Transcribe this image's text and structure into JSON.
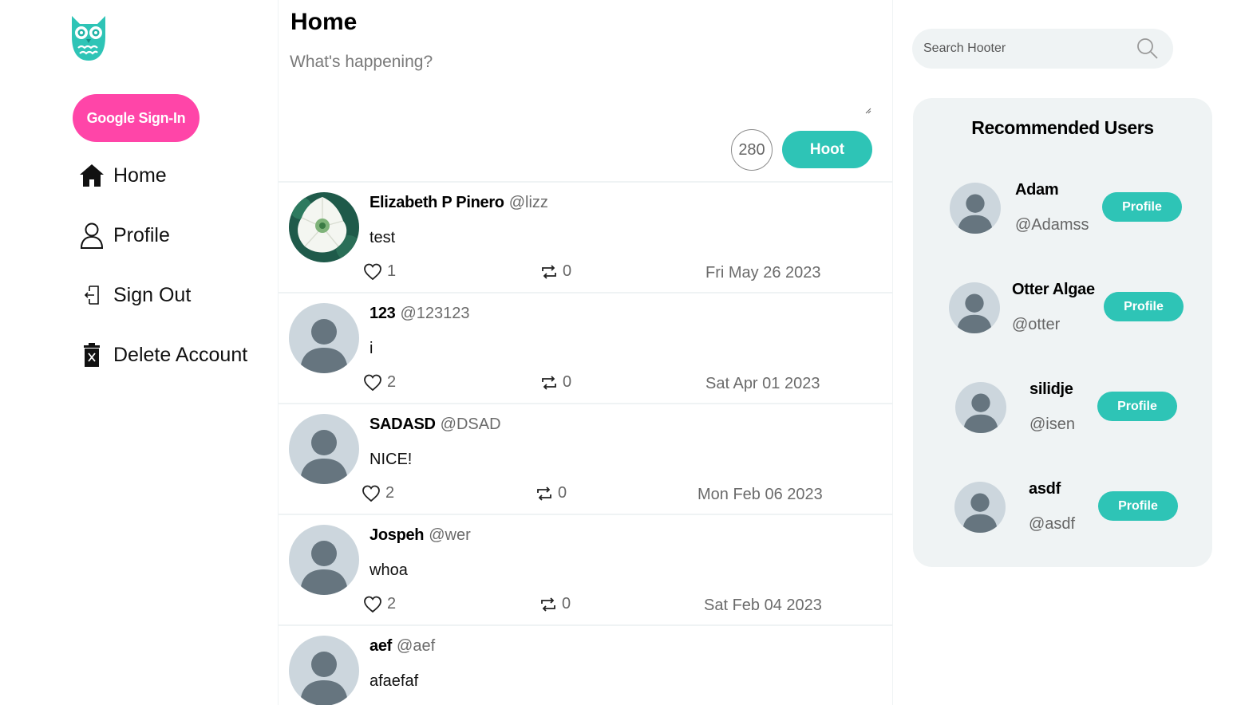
{
  "sidebar": {
    "logo_icon": "owl-logo",
    "google_signin_label": "Google Sign-In",
    "items": [
      {
        "label": "Home",
        "icon": "home-icon"
      },
      {
        "label": "Profile",
        "icon": "user-icon"
      },
      {
        "label": "Sign Out",
        "icon": "sign-out-icon"
      },
      {
        "label": "Delete Account",
        "icon": "trash-icon"
      }
    ]
  },
  "main": {
    "title": "Home",
    "composer": {
      "placeholder": "What's happening?",
      "char_count": "280",
      "submit_label": "Hoot"
    },
    "posts": [
      {
        "name": "Elizabeth P Pinero",
        "handle": "@lizz",
        "body": "test",
        "likes": "1",
        "rehoots": "0",
        "date": "Fri May 26 2023",
        "avatar": "flower-photo"
      },
      {
        "name": "123",
        "handle": "@123123",
        "body": "i",
        "likes": "2",
        "rehoots": "0",
        "date": "Sat Apr 01 2023",
        "avatar": "default-avatar"
      },
      {
        "name": "SADASD",
        "handle": "@DSAD",
        "body": "NICE!",
        "likes": "2",
        "rehoots": "0",
        "date": "Mon Feb 06 2023",
        "avatar": "default-avatar"
      },
      {
        "name": "Jospeh",
        "handle": "@wer",
        "body": "whoa",
        "likes": "2",
        "rehoots": "0",
        "date": "Sat Feb 04 2023",
        "avatar": "default-avatar"
      },
      {
        "name": "aef",
        "handle": "@aef",
        "body": "afaefaf",
        "likes": "",
        "rehoots": "",
        "date": "",
        "avatar": "default-avatar"
      }
    ]
  },
  "right": {
    "search_placeholder": "Search Hooter",
    "recommended_title": "Recommended Users",
    "users": [
      {
        "name": "Adam",
        "handle": "@Adamss",
        "button": "Profile"
      },
      {
        "name": "Otter Algae",
        "handle": "@otter",
        "button": "Profile"
      },
      {
        "name": "silidje",
        "handle": "@isen",
        "button": "Profile"
      },
      {
        "name": "asdf",
        "handle": "@asdf",
        "button": "Profile"
      }
    ]
  },
  "colors": {
    "accent": "#2ec4b6",
    "google_button": "#ff45a8",
    "panel_bg": "#eff3f4",
    "avatar_bg": "#ccd6dd",
    "avatar_fg": "#66757f"
  }
}
